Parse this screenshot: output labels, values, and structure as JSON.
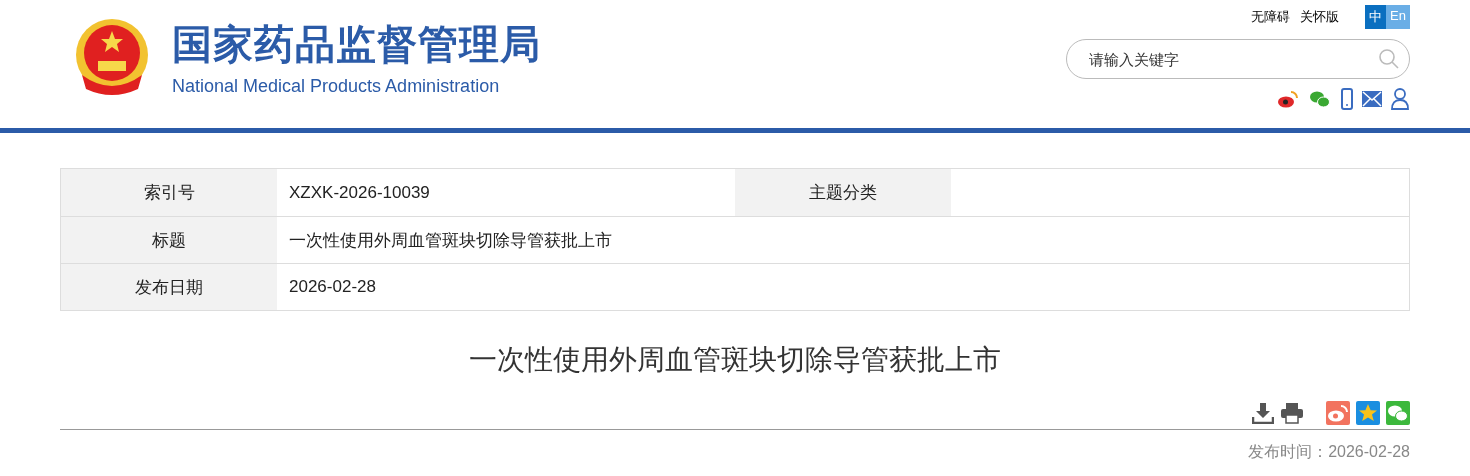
{
  "header": {
    "title_cn": "国家药品监督管理局",
    "title_en": "National Medical Products Administration",
    "links": [
      "无障碍",
      "关怀版"
    ],
    "languages": [
      {
        "label": "中",
        "selected": true
      },
      {
        "label": "En",
        "selected": false
      }
    ],
    "search": {
      "placeholder": "请输入关键字"
    }
  },
  "info_table": {
    "rows": [
      {
        "cells": [
          {
            "kind": "label",
            "text": "索引号"
          },
          {
            "kind": "value",
            "text": "XZXK-2026-10039"
          },
          {
            "kind": "label",
            "text": "主题分类"
          },
          {
            "kind": "value",
            "text": ""
          }
        ]
      },
      {
        "cells": [
          {
            "kind": "label",
            "text": "标题"
          },
          {
            "kind": "wide",
            "text": "一次性使用外周血管斑块切除导管获批上市"
          }
        ]
      },
      {
        "cells": [
          {
            "kind": "label",
            "text": "发布日期"
          },
          {
            "kind": "wide",
            "text": "2026-02-28"
          }
        ]
      }
    ]
  },
  "article": {
    "title": "一次性使用外周血管斑块切除导管获批上市",
    "publish_time": "发布时间：2026-02-28"
  }
}
